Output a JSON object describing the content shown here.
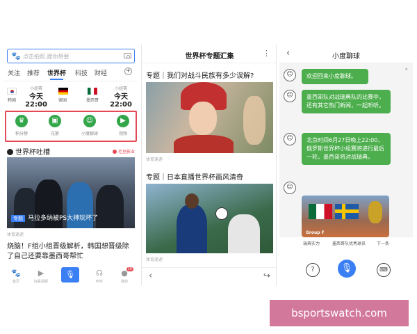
{
  "panel1": {
    "search_placeholder": "点击拍照,搜你想要",
    "tabs": [
      "关注",
      "推荐",
      "世界杯",
      "科技",
      "财经"
    ],
    "match1": {
      "label": "小组赛",
      "time": "今天22:00",
      "team_a": "韩国",
      "team_b": "德国"
    },
    "match2": {
      "label": "小组赛",
      "time": "今天22:00",
      "team_a": "墨西哥"
    },
    "quick_access": [
      {
        "label": "积分榜",
        "icon": "trophy-icon"
      },
      {
        "label": "花絮",
        "icon": "image-icon"
      },
      {
        "label": "小度聊球",
        "icon": "chat-icon"
      },
      {
        "label": "视频",
        "icon": "video-icon"
      }
    ],
    "section_title": "世界杯吐槽",
    "section_brand": "毛豆影业",
    "hero_tag": "专题",
    "hero_text": "马拉多纳被PS大神玩坏了",
    "hero_source": "体育速递",
    "news2": "烧脑！F组小组晋级解析，韩国想晋级除了自己还要靠墨西哥帮忙",
    "bottom_nav": [
      {
        "label": "首页",
        "icon": "paw-icon"
      },
      {
        "label": "好看视频",
        "icon": "play-icon"
      },
      {
        "label": "",
        "icon": "mic-icon"
      },
      {
        "label": "听听",
        "icon": "headphones-icon"
      },
      {
        "label": "我的",
        "icon": "person-icon",
        "badge": "10"
      }
    ]
  },
  "panel2": {
    "header": "世界杯专题汇集",
    "articles": [
      {
        "title": "专题｜我们对战斗民族有多少误解?",
        "source": "体育速递"
      },
      {
        "title": "专题｜日本直播世界杯画风清奇",
        "source": "体育速递"
      }
    ]
  },
  "panel3": {
    "header": "小度聊球",
    "messages": [
      "欢迎回来小度聊球。",
      "墨西哥队对战瑞典队的比赛中，还有其它热门新闻，一起听听。",
      "北京时间6月27日晚上22:00，俄罗斯世界杯小组赛将进行最后一轮，墨西哥将对战瑞典。"
    ],
    "card_label": "Group F",
    "suggestions": [
      "瑞典实力",
      "墨西哥队优秀球员",
      "下一条"
    ]
  },
  "watermark": "bsportswatch.com",
  "colors": {
    "accent": "#3b7ff5",
    "green": "#33a64a",
    "chat_bubble": "#4cae4c",
    "highlight_red": "#e44a55",
    "watermark_bg": "#d2799b"
  }
}
